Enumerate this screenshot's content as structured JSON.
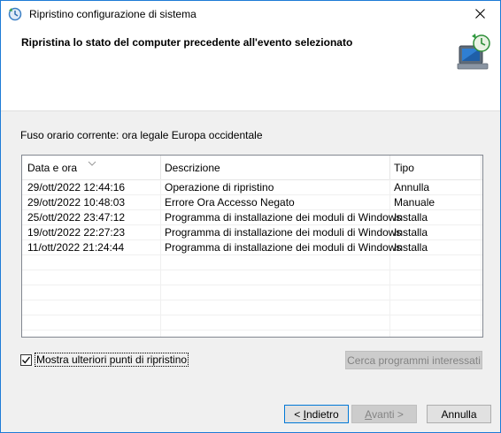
{
  "window": {
    "title": "Ripristino configurazione di sistema"
  },
  "header": {
    "title": "Ripristina lo stato del computer precedente all'evento selezionato"
  },
  "timezone_text": "Fuso orario corrente: ora legale Europa occidentale",
  "table": {
    "columns": [
      "Data e ora",
      "Descrizione",
      "Tipo"
    ],
    "rows": [
      {
        "date": "29/ott/2022 12:44:16",
        "desc": "Operazione di ripristino",
        "type": "Annulla"
      },
      {
        "date": "29/ott/2022 10:48:03",
        "desc": "Errore Ora Accesso Negato",
        "type": "Manuale"
      },
      {
        "date": "25/ott/2022 23:47:12",
        "desc": "Programma di installazione dei moduli di Windows",
        "type": "Installa"
      },
      {
        "date": "19/ott/2022 22:27:23",
        "desc": "Programma di installazione dei moduli di Windows",
        "type": "Installa"
      },
      {
        "date": "11/ott/2022 21:24:44",
        "desc": "Programma di installazione dei moduli di Windows",
        "type": "Installa"
      }
    ]
  },
  "show_more": {
    "label": "Mostra ulteriori punti di ripristino",
    "checked": true
  },
  "buttons": {
    "scan": "Cerca programmi interessati",
    "back_prefix": "< ",
    "back_key": "I",
    "back_rest": "ndietro",
    "next_key": "A",
    "next_rest": "vanti >",
    "cancel": "Annulla"
  },
  "icons": {
    "app": "system-restore-icon",
    "header": "computer-restore-icon",
    "close": "close-icon"
  },
  "colors": {
    "window_border": "#1e7bd6",
    "default_button_border": "#0078d7",
    "dialog_bg": "#f0f0f0"
  }
}
